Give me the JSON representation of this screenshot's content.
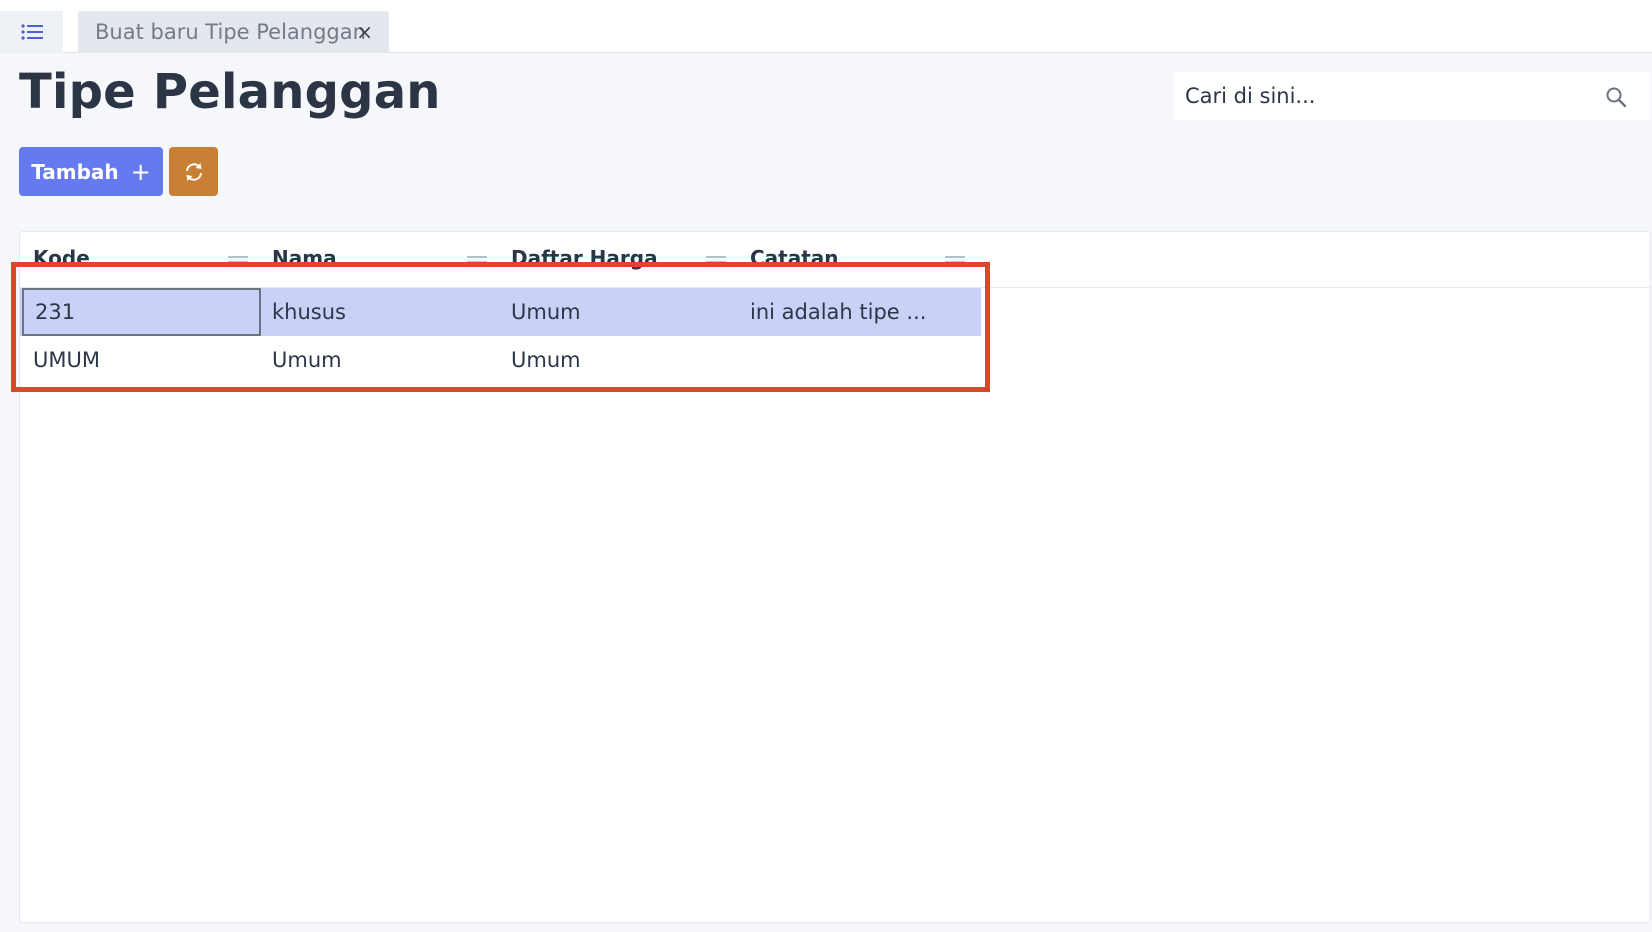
{
  "tabs": [
    {
      "label": "Buat baru Tipe Pelanggan",
      "close": "×"
    }
  ],
  "page": {
    "title": "Tipe Pelanggan"
  },
  "search": {
    "placeholder": "Cari di sini..."
  },
  "toolbar": {
    "add_label": "Tambah",
    "add_plus": "+"
  },
  "table": {
    "columns": [
      "Kode",
      "Nama",
      "Daftar Harga",
      "Catatan"
    ],
    "rows": [
      {
        "kode": "231",
        "nama": "khusus",
        "daftar_harga": "Umum",
        "catatan": "ini adalah tipe ...",
        "selected": true
      },
      {
        "kode": "UMUM",
        "nama": "Umum",
        "daftar_harga": "Umum",
        "catatan": "",
        "selected": false
      }
    ]
  },
  "colors": {
    "primary": "#6579f0",
    "refresh": "#c98034",
    "selected_row": "#c9d2f6",
    "highlight": "#e8402a"
  }
}
